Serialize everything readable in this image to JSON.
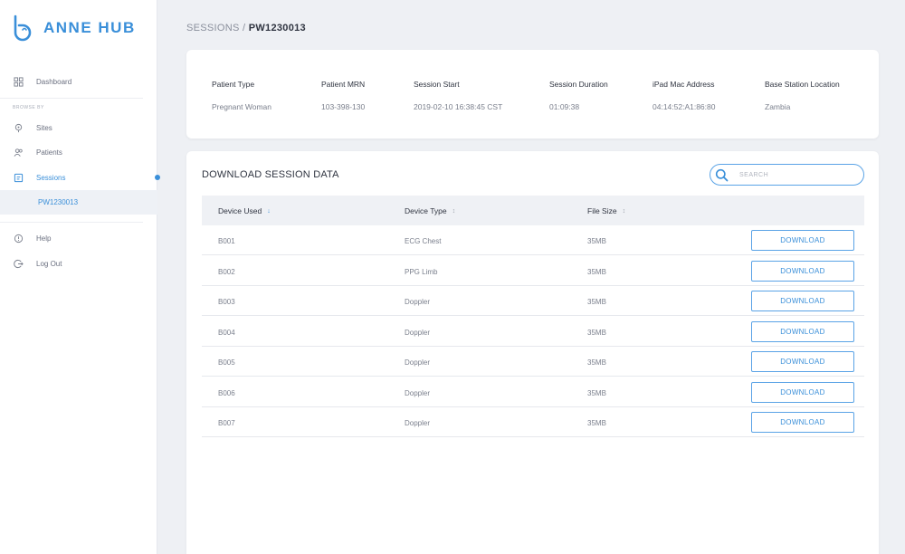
{
  "app": {
    "name": "ANNE HUB",
    "accent": "#3a8fd9"
  },
  "sidebar": {
    "dashboard": "Dashboard",
    "section_label": "BROWSE BY",
    "sites": "Sites",
    "patients": "Patients",
    "sessions": "Sessions",
    "active_session": "PW1230013",
    "help": "Help",
    "logout": "Log Out"
  },
  "breadcrumb": {
    "parent": "SESSIONS",
    "separator": "/",
    "current": "PW1230013"
  },
  "session_info": {
    "columns": [
      {
        "label": "Patient Type",
        "value": "Pregnant Woman"
      },
      {
        "label": "Patient MRN",
        "value": "103-398-130"
      },
      {
        "label": "Session Start",
        "value": "2019-02-10 16:38:45 CST"
      },
      {
        "label": "Session Duration",
        "value": "01:09:38"
      },
      {
        "label": "iPad Mac Address",
        "value": "04:14:52:A1:86:80"
      },
      {
        "label": "Base Station Location",
        "value": "Zambia"
      }
    ]
  },
  "download": {
    "title": "DOWNLOAD SESSION DATA",
    "search_placeholder": "SEARCH",
    "headers": {
      "device_used": "Device Used",
      "device_type": "Device Type",
      "file_size": "File Size"
    },
    "button_label": "DOWNLOAD",
    "rows": [
      {
        "device": "B001",
        "type": "ECG Chest",
        "size": "35MB"
      },
      {
        "device": "B002",
        "type": "PPG Limb",
        "size": "35MB"
      },
      {
        "device": "B003",
        "type": "Doppler",
        "size": "35MB"
      },
      {
        "device": "B004",
        "type": "Doppler",
        "size": "35MB"
      },
      {
        "device": "B005",
        "type": "Doppler",
        "size": "35MB"
      },
      {
        "device": "B006",
        "type": "Doppler",
        "size": "35MB"
      },
      {
        "device": "B007",
        "type": "Doppler",
        "size": "35MB"
      }
    ]
  }
}
